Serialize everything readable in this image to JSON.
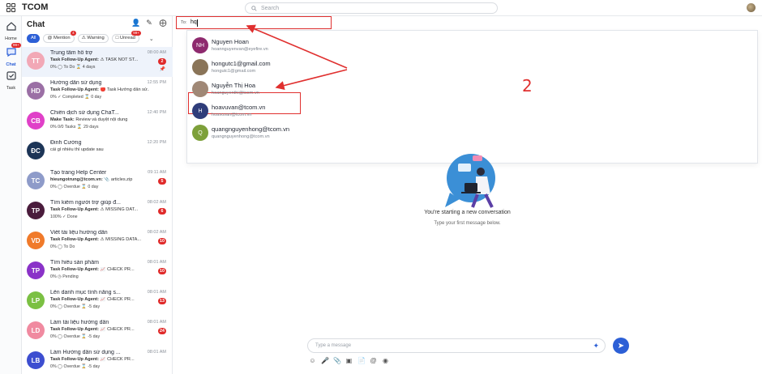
{
  "app": {
    "brand": "TCOM"
  },
  "search": {
    "placeholder": "Search"
  },
  "rail": {
    "items": [
      {
        "label": "Home",
        "icon": "home-icon"
      },
      {
        "label": "Chat",
        "icon": "chat-icon",
        "badge": "99+",
        "active": true
      },
      {
        "label": "Task",
        "icon": "task-icon"
      }
    ]
  },
  "chat_panel": {
    "title": "Chat",
    "filters": [
      {
        "label": "All",
        "active": true,
        "badge": ""
      },
      {
        "label": "@ Mention",
        "badge": "4"
      },
      {
        "label": "⚠ Warning",
        "badge": ""
      },
      {
        "label": "Unread",
        "badge": "99+"
      }
    ],
    "conversations": [
      {
        "avatar_text": "TT",
        "avatar_color": "#f2a8b6",
        "title": "Trung tâm hỗ trợ",
        "time": "08:00 AM",
        "sender": "Task Follow-Up Agent:",
        "preview": "⚠ TASK NOT ST...",
        "status": "0% ◯ To Do ⌛ 4 days",
        "count": "2",
        "pinned": true
      },
      {
        "avatar_text": "HD",
        "avatar_color": "#9b6fa5",
        "title": "Hướng dẫn sử dụng",
        "time": "12:55 PM",
        "sender": "Task Follow-Up Agent:",
        "preview": "🔴 Task Hướng dẫn sử...",
        "status": "0% ✓ Completed ⌛ 0 day",
        "count": ""
      },
      {
        "avatar_text": "CB",
        "avatar_color": "#e040c8",
        "title": "Chiến dịch sử dụng ChaT...",
        "time": "12:40 PM",
        "sender": "Make Task:",
        "preview": "Review và duyệt nội dung",
        "status": "0% 0/0 Tasks ⌛ 29 days",
        "count": ""
      },
      {
        "avatar_text": "ĐC",
        "avatar_color": "#1d3557",
        "title": "Đinh Cường",
        "time": "12:20 PM",
        "sender": "",
        "preview": "cái gì nhiều thì update sau",
        "status": "",
        "count": ""
      },
      {
        "avatar_text": "TC",
        "avatar_color": "#8e9bc9",
        "title": "Tạo trang Help Center",
        "time": "09:11 AM",
        "sender": "hieungotrung@tcom.vn:",
        "preview": "📎 articles.zip",
        "status": "0% ◯ Overdue ⌛ 0 day",
        "count": "5"
      },
      {
        "avatar_text": "TP",
        "avatar_color": "#4a1c3c",
        "title": "Tìm kiếm người trợ giúp đ...",
        "time": "08:02 AM",
        "sender": "Task Follow-Up Agent:",
        "preview": "⚠ MISSING DAT...",
        "status": "100% ✓ Done",
        "count": "6"
      },
      {
        "avatar_text": "VD",
        "avatar_color": "#f07a2a",
        "title": "Viết tài liệu hướng dẫn",
        "time": "08:02 AM",
        "sender": "Task Follow-Up Agent:",
        "preview": "⚠ MISSING DATA...",
        "status": "0% ◯ To Do",
        "count": "10"
      },
      {
        "avatar_text": "TP",
        "avatar_color": "#8a32c8",
        "title": "Tìm hiểu sản phẩm",
        "time": "08:01 AM",
        "sender": "Task Follow-Up Agent:",
        "preview": "📈 CHECK PR...",
        "status": "0% ◷ Pending",
        "count": "10"
      },
      {
        "avatar_text": "LP",
        "avatar_color": "#7bc043",
        "title": "Lên danh mục tính năng s...",
        "time": "08:01 AM",
        "sender": "Task Follow-Up Agent:",
        "preview": "📈 CHECK PR...",
        "status": "0% ◯ Overdue ⌛ -5 day",
        "count": "13"
      },
      {
        "avatar_text": "LD",
        "avatar_color": "#f08aa0",
        "title": "Làm tài liệu hướng dẫn",
        "time": "08:01 AM",
        "sender": "Task Follow-Up Agent:",
        "preview": "📈 CHECK PR...",
        "status": "0% ◯ Overdue ⌛ -5 day",
        "count": "24"
      },
      {
        "avatar_text": "LB",
        "avatar_color": "#3d4ed0",
        "title": "Làm Hướng dẫn sử dụng ...",
        "time": "08:01 AM",
        "sender": "Task Follow-Up Agent:",
        "preview": "📈 CHECK PR...",
        "status": "0% ◯ Overdue ⌛ -5 day",
        "count": ""
      }
    ]
  },
  "to_field": {
    "label": "To:",
    "value": "hq"
  },
  "suggestions": [
    {
      "name": "Nguyen Hoan",
      "email": "hoannguyenvan@eyefire.vn",
      "avatar_text": "NH",
      "avatar_color": "#8e2a6e"
    },
    {
      "name": "hongutc1@gmail.com",
      "email": "hongutc1@gmail.com",
      "avatar_text": "",
      "avatar_color": "#8a7458"
    },
    {
      "name": "Nguyễn Thị Hoa",
      "email": "hoanguyenthi@tcom.vn",
      "avatar_text": "",
      "avatar_color": "#a08876"
    },
    {
      "name": "hoavuvan@tcom.vn",
      "email": "hoavuvan@tcom.vn",
      "avatar_text": "H",
      "avatar_color": "#2f3d7a"
    },
    {
      "name": "quangnguyenhong@tcom.vn",
      "email": "quangnguyenhong@tcom.vn",
      "avatar_text": "Q",
      "avatar_color": "#7da03a"
    }
  ],
  "annotation": {
    "number": "2"
  },
  "empty_state": {
    "title": "You're starting a new conversation",
    "subtitle": "Type your first message below."
  },
  "composer": {
    "placeholder": "Type a message"
  }
}
